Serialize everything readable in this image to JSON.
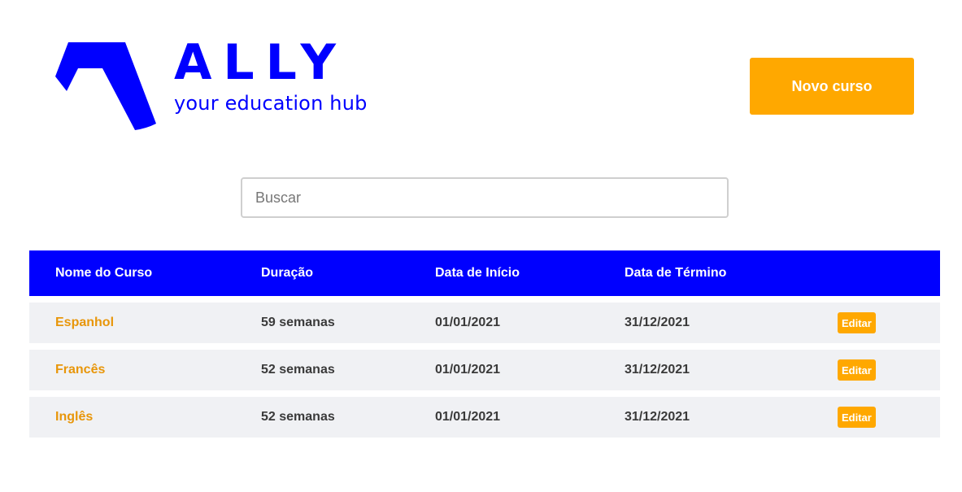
{
  "brand": {
    "name": "ALLY",
    "tagline": "your education hub",
    "color": "#0000ff"
  },
  "header": {
    "new_course_label": "Novo curso",
    "accent_color": "#ffa800"
  },
  "search": {
    "placeholder": "Buscar",
    "value": ""
  },
  "table": {
    "columns": [
      "Nome do Curso",
      "Duração",
      "Data de Início",
      "Data de Término"
    ],
    "rows": [
      {
        "name": "Espanhol",
        "duration": "59 semanas",
        "start": "01/01/2021",
        "end": "31/12/2021",
        "action": "Editar"
      },
      {
        "name": "Francês",
        "duration": "52 semanas",
        "start": "01/01/2021",
        "end": "31/12/2021",
        "action": "Editar"
      },
      {
        "name": "Inglês",
        "duration": "52 semanas",
        "start": "01/01/2021",
        "end": "31/12/2021",
        "action": "Editar"
      }
    ],
    "header_color": "#0000ff",
    "row_color": "#f0f1f4"
  }
}
